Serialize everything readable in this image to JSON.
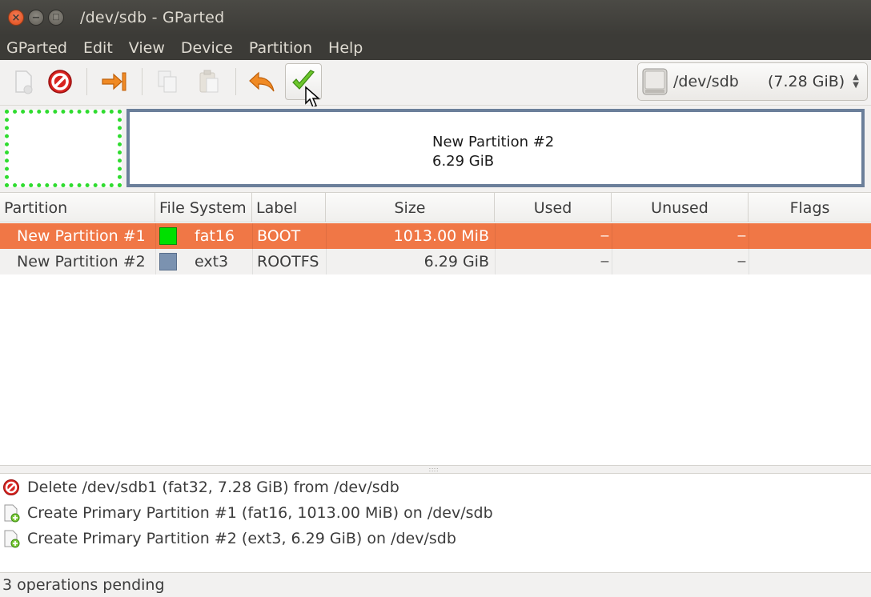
{
  "window": {
    "title": "/dev/sdb - GParted"
  },
  "menu": [
    "GParted",
    "Edit",
    "View",
    "Device",
    "Partition",
    "Help"
  ],
  "toolbar": {
    "buttons": [
      {
        "name": "new",
        "icon": "new-partition-icon",
        "enabled": false
      },
      {
        "name": "delete",
        "icon": "delete-icon",
        "enabled": true
      },
      {
        "name": "resize-move",
        "icon": "resize-move-icon",
        "enabled": true
      },
      {
        "name": "copy",
        "icon": "copy-icon",
        "enabled": false
      },
      {
        "name": "paste",
        "icon": "paste-icon",
        "enabled": false
      },
      {
        "name": "undo",
        "icon": "undo-icon",
        "enabled": true
      },
      {
        "name": "apply",
        "icon": "apply-checkmark-icon",
        "enabled": true
      }
    ],
    "device": {
      "label": "/dev/sdb",
      "size": "(7.28 GiB)"
    }
  },
  "disk_map": {
    "partition2": {
      "name": "New Partition #2",
      "size": "6.29 GiB"
    }
  },
  "table": {
    "columns": [
      "Partition",
      "File System",
      "Label",
      "Size",
      "Used",
      "Unused",
      "Flags"
    ],
    "rows": [
      {
        "partition": "New Partition #1",
        "fs": "fat16",
        "fs_color": "#00e000",
        "label": "BOOT",
        "size": "1013.00 MiB",
        "used": "---",
        "unused": "---",
        "flags": "",
        "selected": true
      },
      {
        "partition": "New Partition #2",
        "fs": "ext3",
        "fs_color": "#7b92b0",
        "label": "ROOTFS",
        "size": "6.29 GiB",
        "used": "---",
        "unused": "---",
        "flags": "",
        "selected": false
      }
    ]
  },
  "operations": [
    {
      "icon": "delete-icon",
      "text": "Delete /dev/sdb1 (fat32, 7.28 GiB) from /dev/sdb"
    },
    {
      "icon": "create-partition-icon",
      "text": "Create Primary Partition #1 (fat16, 1013.00 MiB) on /dev/sdb"
    },
    {
      "icon": "create-partition-icon",
      "text": "Create Primary Partition #2 (ext3, 6.29 GiB) on /dev/sdb"
    }
  ],
  "status": "3 operations pending",
  "colors": {
    "selection": "#f07746",
    "fat16": "#00e000",
    "ext3": "#7b92b0"
  }
}
